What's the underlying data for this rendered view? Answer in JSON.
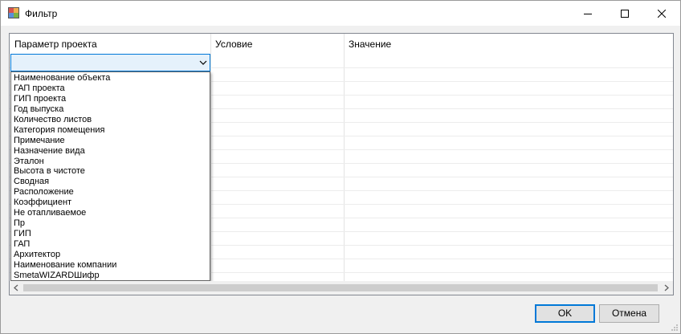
{
  "window": {
    "title": "Фильтр",
    "accent_color": "#0078d7"
  },
  "grid": {
    "columns": [
      "Параметр проекта",
      "Условие",
      "Значение"
    ],
    "combo_value": ""
  },
  "dropdown": {
    "items": [
      "Наименование объекта",
      "ГАП проекта",
      "ГИП проекта",
      "Год выпуска",
      "Количество листов",
      "Категория помещения",
      "Примечание",
      "Назначение вида",
      "Эталон",
      "Высота в чистоте",
      "Сводная",
      "Расположение",
      "Коэффициент",
      "Не отапливаемое",
      "Пр",
      "ГИП",
      "ГАП",
      "Архитектор",
      "Наименование компании",
      "SmetaWIZARDШифр"
    ]
  },
  "buttons": {
    "ok": "OK",
    "cancel": "Отмена"
  }
}
